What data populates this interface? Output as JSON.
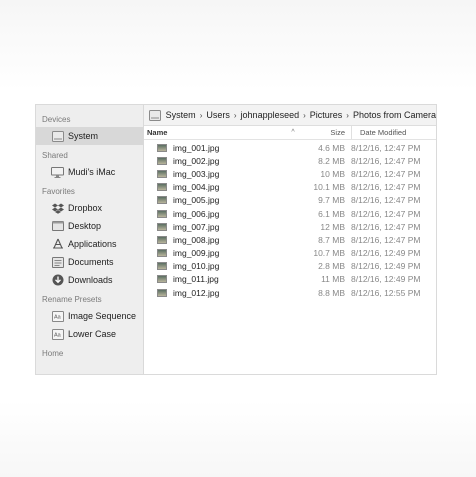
{
  "sidebar": {
    "sections": [
      {
        "header": "Devices",
        "items": [
          {
            "label": "System",
            "icon": "hard-drive-icon",
            "selected": true
          }
        ]
      },
      {
        "header": "Shared",
        "items": [
          {
            "label": "Mudi's iMac",
            "icon": "imac-icon"
          }
        ]
      },
      {
        "header": "Favorites",
        "items": [
          {
            "label": "Dropbox",
            "icon": "dropbox-icon"
          },
          {
            "label": "Desktop",
            "icon": "desktop-icon"
          },
          {
            "label": "Applications",
            "icon": "applications-icon"
          },
          {
            "label": "Documents",
            "icon": "documents-icon"
          },
          {
            "label": "Downloads",
            "icon": "downloads-icon"
          }
        ]
      },
      {
        "header": "Rename Presets",
        "items": [
          {
            "label": "Image Sequence",
            "icon": "preset-icon"
          },
          {
            "label": "Lower Case",
            "icon": "preset-icon"
          }
        ]
      },
      {
        "header": "Home",
        "items": []
      }
    ]
  },
  "path": [
    "System",
    "Users",
    "johnappleseed",
    "Pictures",
    "Photos from Camera"
  ],
  "columns": {
    "name": "Name",
    "sort_indicator": "^",
    "size": "Size",
    "date": "Date Modified"
  },
  "files": [
    {
      "name": "img_001.jpg",
      "size": "4.6 MB",
      "date": "8/12/16, 12:47 PM"
    },
    {
      "name": "img_002.jpg",
      "size": "8.2 MB",
      "date": "8/12/16, 12:47 PM"
    },
    {
      "name": "img_003.jpg",
      "size": "10 MB",
      "date": "8/12/16, 12:47 PM"
    },
    {
      "name": "img_004.jpg",
      "size": "10.1 MB",
      "date": "8/12/16, 12:47 PM"
    },
    {
      "name": "img_005.jpg",
      "size": "9.7 MB",
      "date": "8/12/16, 12:47 PM"
    },
    {
      "name": "img_006.jpg",
      "size": "6.1 MB",
      "date": "8/12/16, 12:47 PM"
    },
    {
      "name": "img_007.jpg",
      "size": "12 MB",
      "date": "8/12/16, 12:47 PM"
    },
    {
      "name": "img_008.jpg",
      "size": "8.7 MB",
      "date": "8/12/16, 12:47 PM"
    },
    {
      "name": "img_009.jpg",
      "size": "10.7 MB",
      "date": "8/12/16, 12:49 PM"
    },
    {
      "name": "img_010.jpg",
      "size": "2.8 MB",
      "date": "8/12/16, 12:49 PM"
    },
    {
      "name": "img_011.jpg",
      "size": "11 MB",
      "date": "8/12/16, 12:49 PM"
    },
    {
      "name": "img_012.jpg",
      "size": "8.8 MB",
      "date": "8/12/16, 12:55 PM"
    }
  ]
}
